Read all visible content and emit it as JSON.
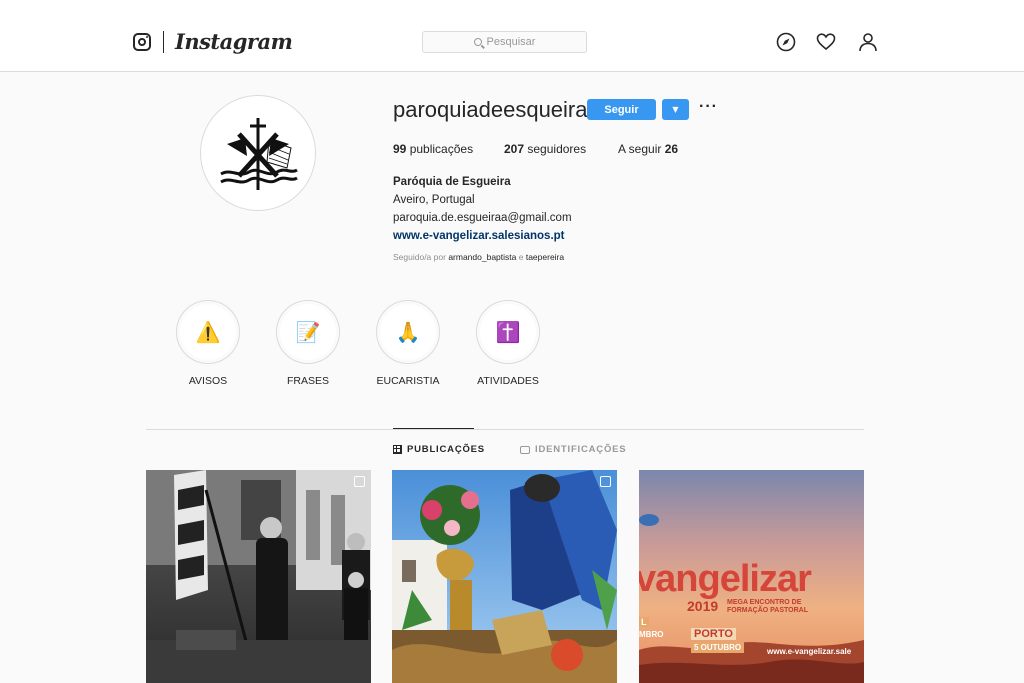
{
  "header": {
    "brand": "Instagram",
    "search_placeholder": "Pesquisar"
  },
  "profile": {
    "username": "paroquiadeesqueira",
    "follow_label": "Seguir",
    "dropdown_glyph": "▼",
    "more_glyph": "···",
    "stats": {
      "posts_count": "99",
      "posts_label": "publicações",
      "followers_count": "207",
      "followers_label": "seguidores",
      "following_label": "A seguir",
      "following_count": "26"
    },
    "full_name": "Paróquia de Esgueira",
    "location": "Aveiro, Portugal",
    "email": "paroquia.de.esgueiraa@gmail.com",
    "website": "www.e-vangelizar.salesianos.pt",
    "followed_by": {
      "prefix": "Seguido/a por",
      "user1": "armando_baptista",
      "joiner": "e",
      "user2": "taepereira"
    }
  },
  "highlights": [
    {
      "label": "AVISOS",
      "emoji": "⚠️",
      "icon": "warning-icon"
    },
    {
      "label": "FRASES",
      "emoji": "📝",
      "icon": "memo-icon"
    },
    {
      "label": "EUCARISTIA",
      "emoji": "🙏",
      "icon": "praying-hands-icon"
    },
    {
      "label": "ATIVIDADES",
      "emoji": "✝️",
      "icon": "cross-icon"
    }
  ],
  "tabs": {
    "posts": "PUBLICAÇÕES",
    "tagged": "IDENTIFICAÇÕES"
  },
  "posts": {
    "p3": {
      "headline": "vangelizar",
      "year": "2019",
      "subtitle_1": "MEGA ENCONTRO DE",
      "subtitle_2": "FORMAÇÃO PASTORAL",
      "left_fragment_1": "L",
      "left_fragment_2": "MBRO",
      "city": "PORTO",
      "date": "5 OUTUBRO",
      "url": "www.e-vangelizar.sale"
    }
  },
  "colors": {
    "accent": "#3897f0",
    "link": "#003569",
    "border": "#dbdbdb"
  }
}
